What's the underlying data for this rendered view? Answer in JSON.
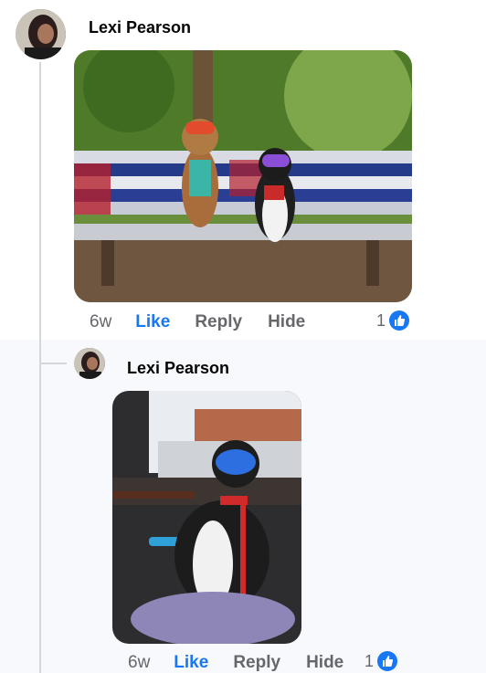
{
  "comment": {
    "author": "Lexi Pearson",
    "time": "6w",
    "like_label": "Like",
    "reply_label": "Reply",
    "hide_label": "Hide",
    "reaction_count": "1",
    "reaction_icon": "thumbs-up-icon"
  },
  "reply": {
    "author": "Lexi Pearson",
    "time": "6w",
    "like_label": "Like",
    "reply_label": "Reply",
    "hide_label": "Hide",
    "reaction_count": "1",
    "reaction_icon": "thumbs-up-icon"
  },
  "colors": {
    "like": "#1877f2",
    "muted": "#65676b",
    "name": "#050505"
  }
}
